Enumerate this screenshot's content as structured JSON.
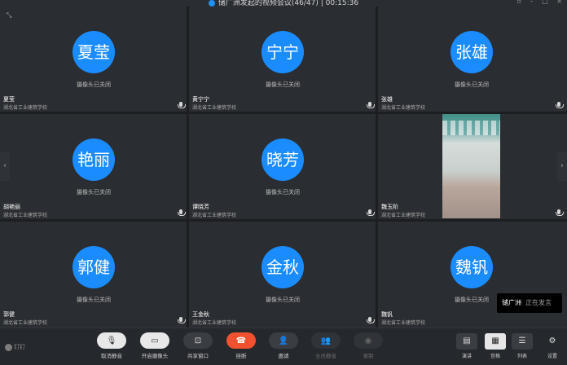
{
  "window": {
    "title": "储广洲发起的视频会议(46/47) | 00:15:36"
  },
  "tiles": [
    {
      "avatar": "夏莹",
      "cam": "摄像头已关闭",
      "name": "夏莹",
      "org": "湖北省工业建筑学校"
    },
    {
      "avatar": "宁宁",
      "cam": "摄像头已关闭",
      "name": "黄宁宁",
      "org": "湖北省工业建筑学校"
    },
    {
      "avatar": "张雄",
      "cam": "摄像头已关闭",
      "name": "张雄",
      "org": "湖北省工业建筑学校"
    },
    {
      "avatar": "艳丽",
      "cam": "摄像头已关闭",
      "name": "胡艳丽",
      "org": "湖北省工业建筑学校"
    },
    {
      "avatar": "晓芳",
      "cam": "摄像头已关闭",
      "name": "谭晓芳",
      "org": "湖北省工业建筑学校"
    },
    {
      "avatar": "",
      "cam": "",
      "name": "魏玉阶",
      "org": "湖北省工业建筑学校"
    },
    {
      "avatar": "郭健",
      "cam": "摄像头已关闭",
      "name": "郭健",
      "org": "湖北省工业建筑学校"
    },
    {
      "avatar": "金秋",
      "cam": "摄像头已关闭",
      "name": "王金秋",
      "org": "湖北省工业建筑学校"
    },
    {
      "avatar": "魏钒",
      "cam": "摄像头已关闭",
      "name": "魏钒",
      "org": "湖北省工业建筑学校"
    }
  ],
  "speaking": {
    "name": "储广洲",
    "status": "正在发言"
  },
  "toolbar": {
    "brand": "钉钉",
    "unmute": "取消静音",
    "camera": "开启摄像头",
    "share": "共享窗口",
    "hangup": "挂断",
    "invite": "邀请",
    "mute_all": "全员静音",
    "record": "录制",
    "layout_speaker": "演讲",
    "layout_grid": "宫格",
    "layout_list": "列表",
    "settings": "设置"
  }
}
